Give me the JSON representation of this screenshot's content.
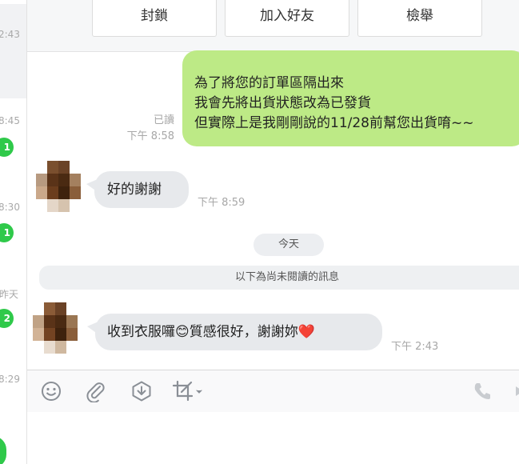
{
  "sidebar": {
    "times": [
      "2:43",
      "8:45",
      "8:30",
      "昨天",
      "8:29"
    ],
    "badges": [
      "1",
      "1",
      "2"
    ]
  },
  "actions": {
    "block": "封鎖",
    "add_friend": "加入好友",
    "report": "檢舉"
  },
  "messages": {
    "outgoing": {
      "lines": [
        "為了將您的訂單區隔出來",
        "我會先將出貨狀態改為已發貨",
        "但實際上是我剛剛說的11/28前幫您出貨唷~~"
      ],
      "read_label": "已讀",
      "time": "下午 8:58"
    },
    "reply1": {
      "text": "好的謝謝",
      "time": "下午 8:59"
    },
    "date_divider": "今天",
    "unread_divider": "以下為尚未閱讀的訊息",
    "reply2": {
      "text_a": "收到衣服囉",
      "emoji_a": "😊",
      "text_b": "質感很好，謝謝妳",
      "emoji_b": "❤️",
      "time": "下午 2:43"
    }
  },
  "colors": {
    "outgoing_bubble": "#bdea86",
    "incoming_bubble": "#e7e9ec",
    "badge": "#2fc94a"
  },
  "toolbar_icons": [
    "emoji-icon",
    "paperclip-icon",
    "download-icon",
    "crop-icon",
    "phone-icon"
  ]
}
